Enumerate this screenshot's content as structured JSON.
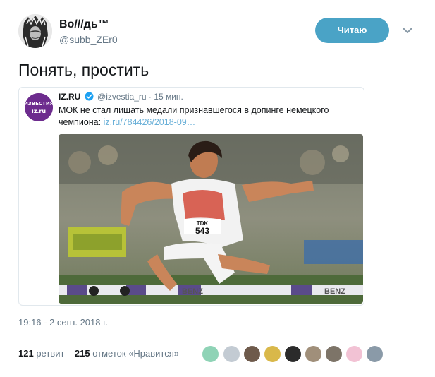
{
  "author": {
    "name": "Во///дь™",
    "handle": "@subb_ZEr0",
    "avatar_icon": "native-chief-portrait-icon"
  },
  "follow_button": {
    "label": "Читаю",
    "color": "#4aa3c6"
  },
  "menu_icon": "chevron-down-icon",
  "tweet": {
    "text": "Понять, простить"
  },
  "quoted": {
    "avatar_lines": [
      "ИЗВЕСТИЯ",
      "iz.ru"
    ],
    "avatar_color": "#6d2c8e",
    "name": "IZ.RU",
    "verified_icon": "verified-badge-icon",
    "handle": "@izvestia_ru",
    "separator": "·",
    "time": "15 мин.",
    "text": "МОК не стал лишать медали признавшегося в допинге немецкого чемпиона:",
    "link": "iz.ru/784426/2018-09…",
    "photo": {
      "bib_brand": "TDK",
      "bib_number": "543",
      "hurdle_left": "BENZ",
      "hurdle_right": "BENZ"
    }
  },
  "timestamp": "19:16 - 2 сент. 2018 г.",
  "stats": {
    "retweets": "121",
    "retweets_label": "ретвит",
    "likes": "215",
    "likes_label": "отметок «Нравится»"
  },
  "likers_count": 9
}
